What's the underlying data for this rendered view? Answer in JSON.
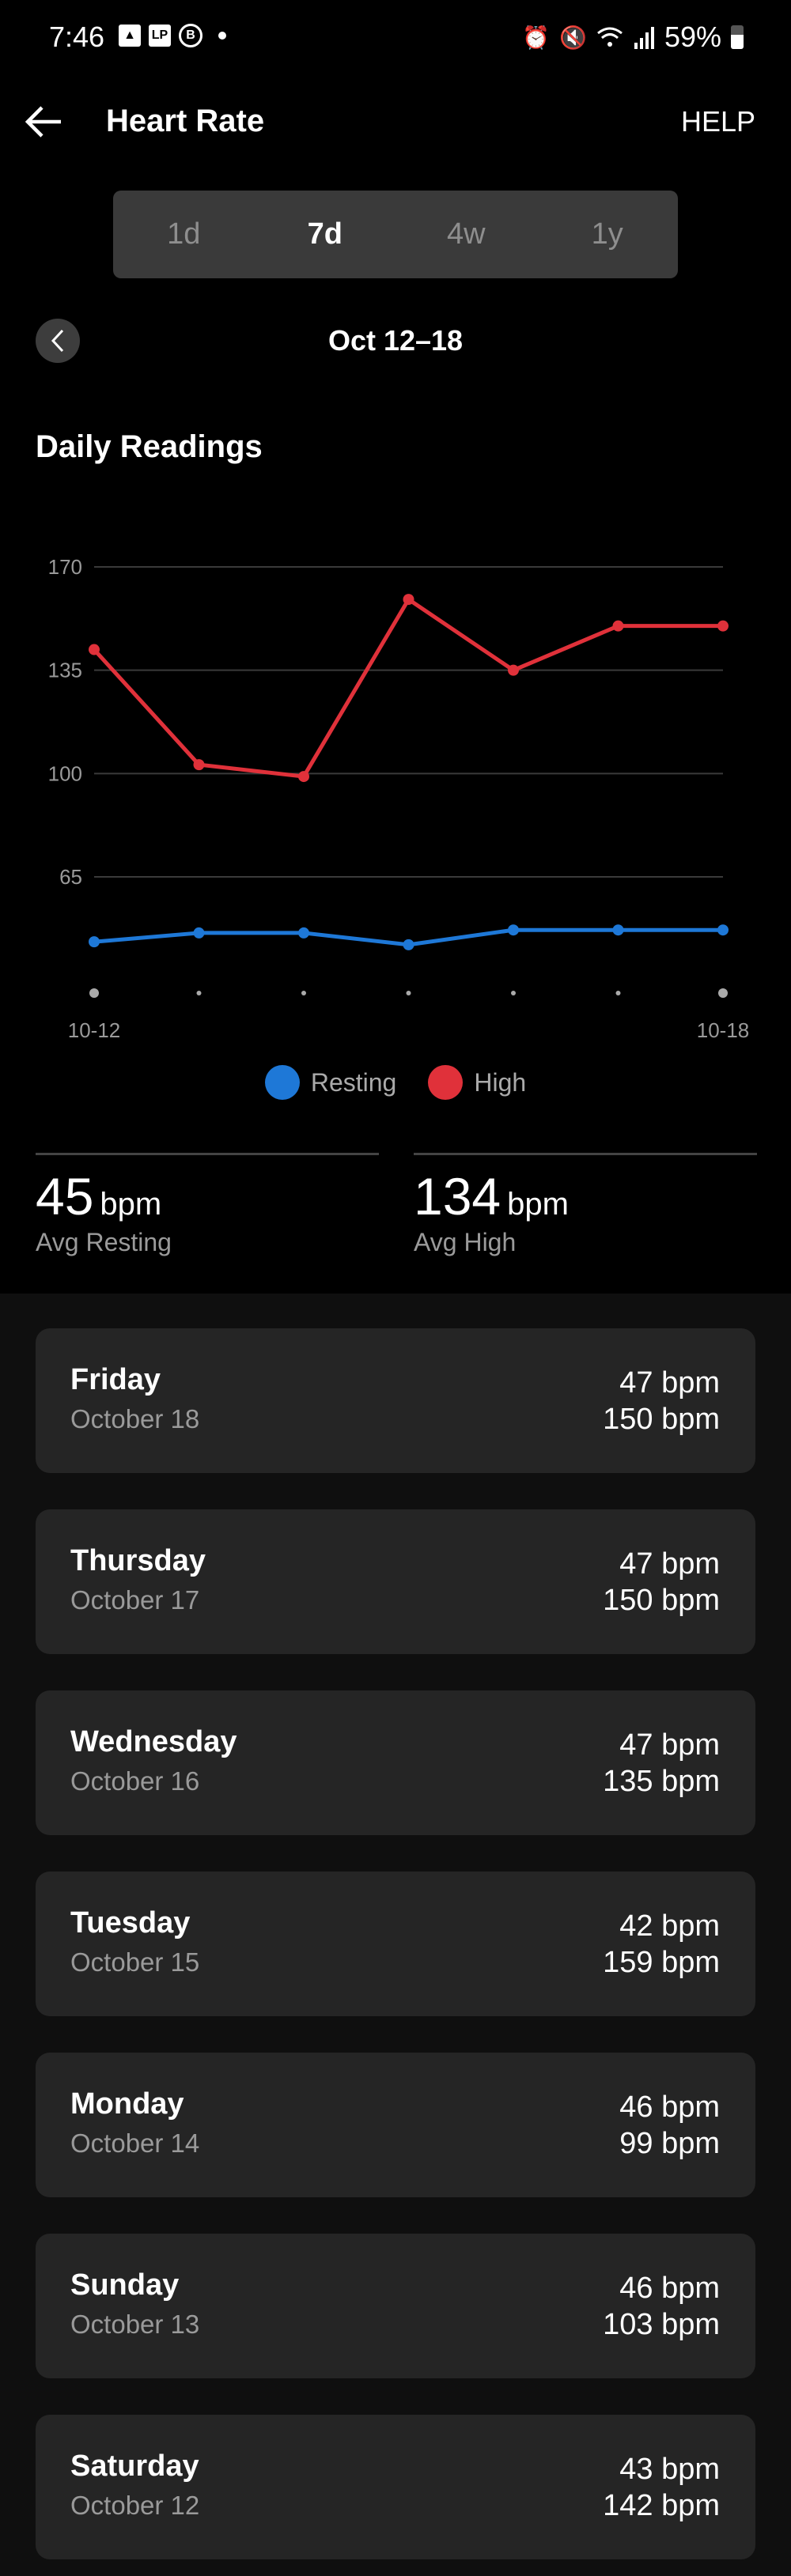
{
  "status_bar": {
    "time": "7:46",
    "left_icons": [
      "gallery-icon",
      "lp-icon",
      "b-chat-icon",
      "notification-dot-icon"
    ],
    "right_icons": [
      "alarm-icon",
      "mute-icon",
      "wifi-icon",
      "signal-icon"
    ],
    "battery": "59%"
  },
  "app_bar": {
    "title": "Heart Rate",
    "help_label": "HELP"
  },
  "range_tabs": [
    {
      "label": "1d",
      "active": false
    },
    {
      "label": "7d",
      "active": true
    },
    {
      "label": "4w",
      "active": false
    },
    {
      "label": "1y",
      "active": false
    }
  ],
  "date_range": "Oct 12–18",
  "section_title": "Daily Readings",
  "colors": {
    "resting": "#1e78d7",
    "high": "#e0313a",
    "grid": "#3a3a3a"
  },
  "chart_data": {
    "type": "line",
    "title": "Daily Readings",
    "x": [
      "10-12",
      "10-13",
      "10-14",
      "10-15",
      "10-16",
      "10-17",
      "10-18"
    ],
    "x_tick_labels": [
      "10-12",
      "",
      "",
      "",
      "",
      "",
      "10-18"
    ],
    "y_ticks": [
      65,
      100,
      135,
      170
    ],
    "ylim": [
      30,
      170
    ],
    "grid": true,
    "legend_position": "bottom",
    "series": [
      {
        "name": "Resting",
        "color": "#1e78d7",
        "values": [
          43,
          46,
          46,
          42,
          47,
          47,
          47
        ]
      },
      {
        "name": "High",
        "color": "#e0313a",
        "values": [
          142,
          103,
          99,
          159,
          135,
          150,
          150
        ]
      }
    ]
  },
  "legend": [
    {
      "label": "Resting",
      "color": "#1e78d7"
    },
    {
      "label": "High",
      "color": "#e0313a"
    }
  ],
  "summary": {
    "resting": {
      "value": "45",
      "unit": "bpm",
      "label": "Avg Resting"
    },
    "high": {
      "value": "134",
      "unit": "bpm",
      "label": "Avg High"
    }
  },
  "days": [
    {
      "day": "Friday",
      "date": "October 18",
      "resting": "47 bpm",
      "high": "150 bpm"
    },
    {
      "day": "Thursday",
      "date": "October 17",
      "resting": "47 bpm",
      "high": "150 bpm"
    },
    {
      "day": "Wednesday",
      "date": "October 16",
      "resting": "47 bpm",
      "high": "135 bpm"
    },
    {
      "day": "Tuesday",
      "date": "October 15",
      "resting": "42 bpm",
      "high": "159 bpm"
    },
    {
      "day": "Monday",
      "date": "October 14",
      "resting": "46 bpm",
      "high": "99 bpm"
    },
    {
      "day": "Sunday",
      "date": "October 13",
      "resting": "46 bpm",
      "high": "103 bpm"
    },
    {
      "day": "Saturday",
      "date": "October 12",
      "resting": "43 bpm",
      "high": "142 bpm"
    }
  ]
}
